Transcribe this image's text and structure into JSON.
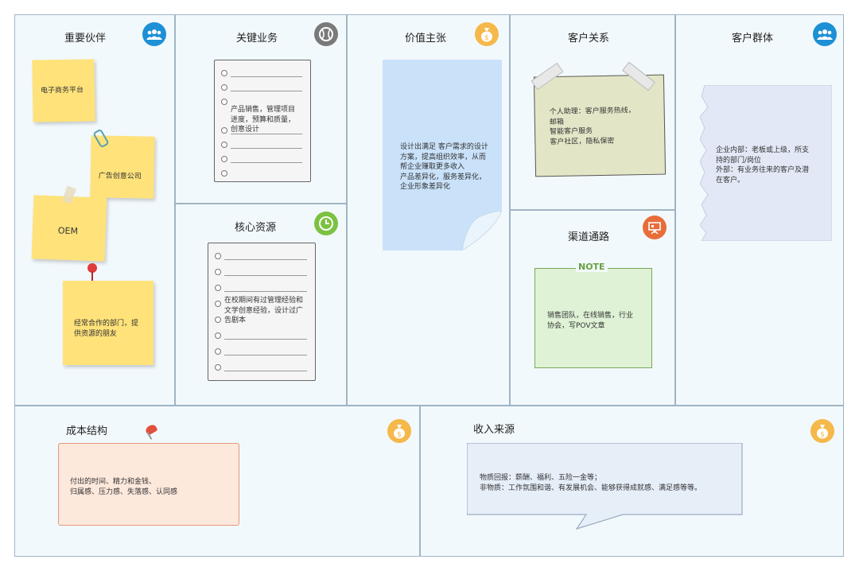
{
  "partners": {
    "title": "重要伙伴",
    "icon": "users-icon",
    "notes": [
      "电子商务平台",
      "广告创意公司",
      "OEM",
      "经常合作的部门，提\n供资源的朋友"
    ]
  },
  "activities": {
    "title": "关键业务",
    "icon": "baseball-icon",
    "text": "产品销售，管理项目\n进度，预算和质量，\n创意设计"
  },
  "resources": {
    "title": "核心资源",
    "icon": "clock-icon",
    "text": "在校期间有过管理经验和\n文学创意经验，设计过广\n告剧本"
  },
  "value": {
    "title": "价值主张",
    "icon": "money-bag-icon",
    "text": "设计出满足 客户需求的设计\n方案，提高组织效率，从而\n帮企业赚取更多收入\n产品差异化，服务差异化，\n企业形象差异化"
  },
  "relationships": {
    "title": "客户关系",
    "text": "个人助理：客户服务热线，\n邮箱\n智能客户服务\n客户社区，隐私保密"
  },
  "channels": {
    "title": "渠道通路",
    "icon": "presentation-icon",
    "note_label": "NOTE",
    "text": "销售团队，在线销售，行业\n协会，写POV文章"
  },
  "segments": {
    "title": "客户群体",
    "icon": "users-icon",
    "text": "企业内部：老板或上级，所支\n持的部门/岗位\n外部：有业务往来的客户及潜\n在客户。"
  },
  "cost": {
    "title": "成本结构",
    "icon": "money-bag-icon",
    "text": "付出的时间、精力和金钱、\n归属感、压力感、失落感、认同感"
  },
  "revenue": {
    "title": "收入来源",
    "icon": "money-bag-icon",
    "text": "物质回报：薪酬、福利、五险一金等；\n非物质：工作氛围和谐、有发展机会、能够获得成就感、满足感等等。"
  },
  "colors": {
    "blue_badge": "#1e90d6",
    "gray_badge": "#7a7a7a",
    "green_badge": "#7cc242",
    "orange_badge": "#e86d3a",
    "gold_badge": "#f5b84a"
  }
}
